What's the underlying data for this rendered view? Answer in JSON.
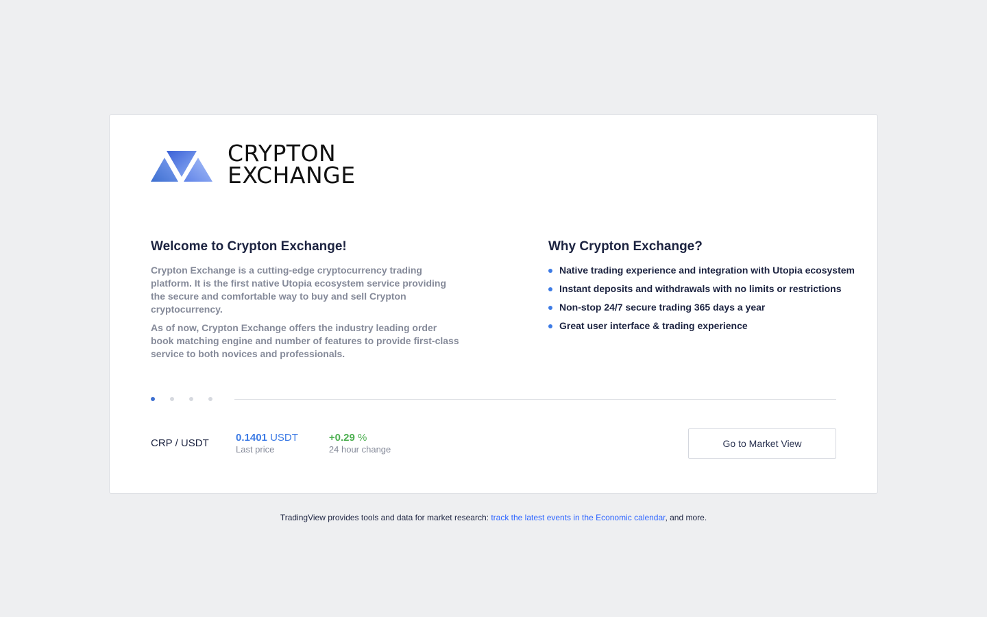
{
  "brand": {
    "line1": "CRYPTON",
    "line2": "EXCHANGE",
    "logo_icon": "crypton-triangles-logo",
    "colors": {
      "primary": "#3d6fd0",
      "light": "#8aa8ef"
    }
  },
  "welcome": {
    "title": "Welcome to Crypton Exchange!",
    "paragraphs": [
      "Crypton Exchange is a cutting-edge cryptocurrency trading platform. It is the first native Utopia ecosystem service providing the secure and comfortable way to buy and sell Crypton cryptocurrency.",
      "As of now, Crypton Exchange offers the industry leading order book matching engine and number of features to provide first-class service to both novices and professionals."
    ]
  },
  "why": {
    "title": "Why Crypton Exchange?",
    "features": [
      "Native trading experience and integration with Utopia ecosystem",
      "Instant deposits and withdrawals with no limits or restrictions",
      "Non-stop 24/7 secure trading 365 days a year",
      "Great user interface & trading experience"
    ]
  },
  "pager": {
    "total": 4,
    "active": 1
  },
  "ticker": {
    "pair": "CRP / USDT",
    "last_price": {
      "value": "0.1401",
      "unit": "USDT",
      "label": "Last price"
    },
    "change": {
      "value": "+0.29",
      "unit": "%",
      "label": "24 hour change"
    }
  },
  "actions": {
    "market_view_label": "Go to Market View"
  },
  "footer": {
    "prefix": "TradingView provides tools and data for market research: ",
    "link_text": "track the latest events in the Economic calendar",
    "suffix": ", and more."
  },
  "colors": {
    "background": "#eeeff1",
    "accent": "#3d7be5",
    "positive": "#4caf50",
    "link": "#2962ff"
  }
}
